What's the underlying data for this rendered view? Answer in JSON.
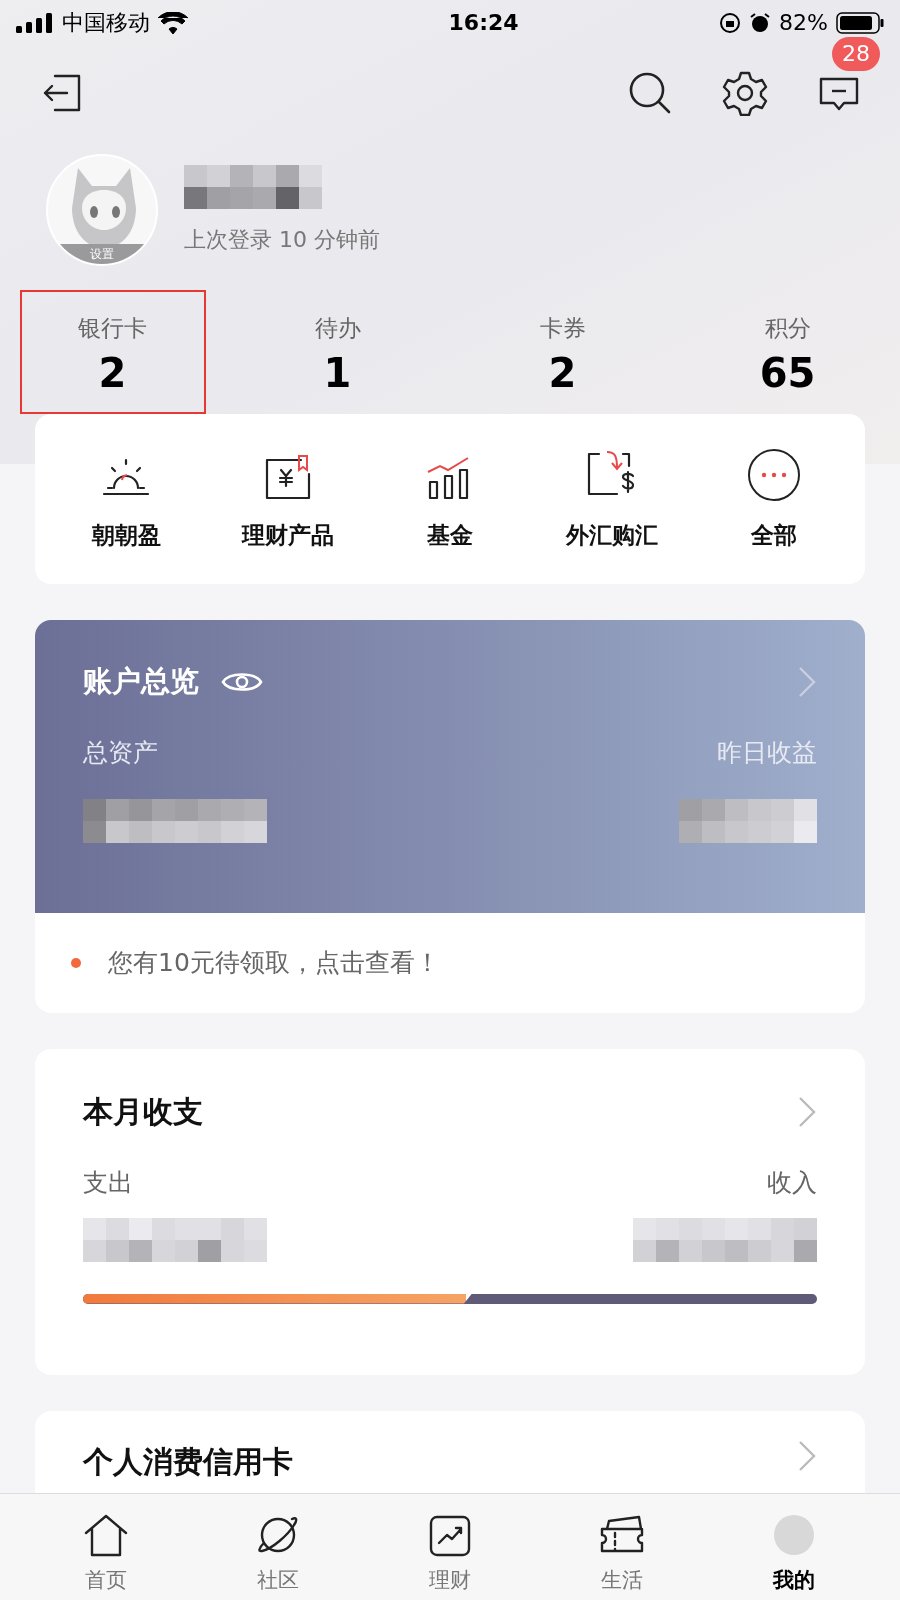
{
  "status_bar": {
    "carrier": "中国移动",
    "time": "16:24",
    "battery": "82%"
  },
  "header": {
    "badge": "28"
  },
  "profile": {
    "avatar_label": "设置",
    "last_login": "上次登录 10 分钟前"
  },
  "stats": [
    {
      "label": "银行卡",
      "value": "2",
      "highlighted": true
    },
    {
      "label": "待办",
      "value": "1",
      "highlighted": false
    },
    {
      "label": "卡券",
      "value": "2",
      "highlighted": false
    },
    {
      "label": "积分",
      "value": "65",
      "highlighted": false
    }
  ],
  "quick_actions": [
    {
      "kind": "sunrise",
      "label": "朝朝盈"
    },
    {
      "kind": "product",
      "label": "理财产品"
    },
    {
      "kind": "fund",
      "label": "基金"
    },
    {
      "kind": "forex",
      "label": "外汇购汇"
    },
    {
      "kind": "more",
      "label": "全部"
    }
  ],
  "account_overview": {
    "title": "账户总览",
    "total_label": "总资产",
    "yesterday_label": "昨日收益",
    "notice": "您有10元待领取，点击查看！"
  },
  "monthly": {
    "title": "本月收支",
    "expense_label": "支出",
    "income_label": "收入",
    "level": 0.53
  },
  "credit_card": {
    "title": "个人消费信用卡"
  },
  "tab_bar": [
    {
      "kind": "home",
      "label": "首页",
      "selected": false
    },
    {
      "kind": "community",
      "label": "社区",
      "selected": false
    },
    {
      "kind": "wealth",
      "label": "理财",
      "selected": false
    },
    {
      "kind": "life",
      "label": "生活",
      "selected": false
    },
    {
      "kind": "mine",
      "label": "我的",
      "selected": true
    }
  ]
}
